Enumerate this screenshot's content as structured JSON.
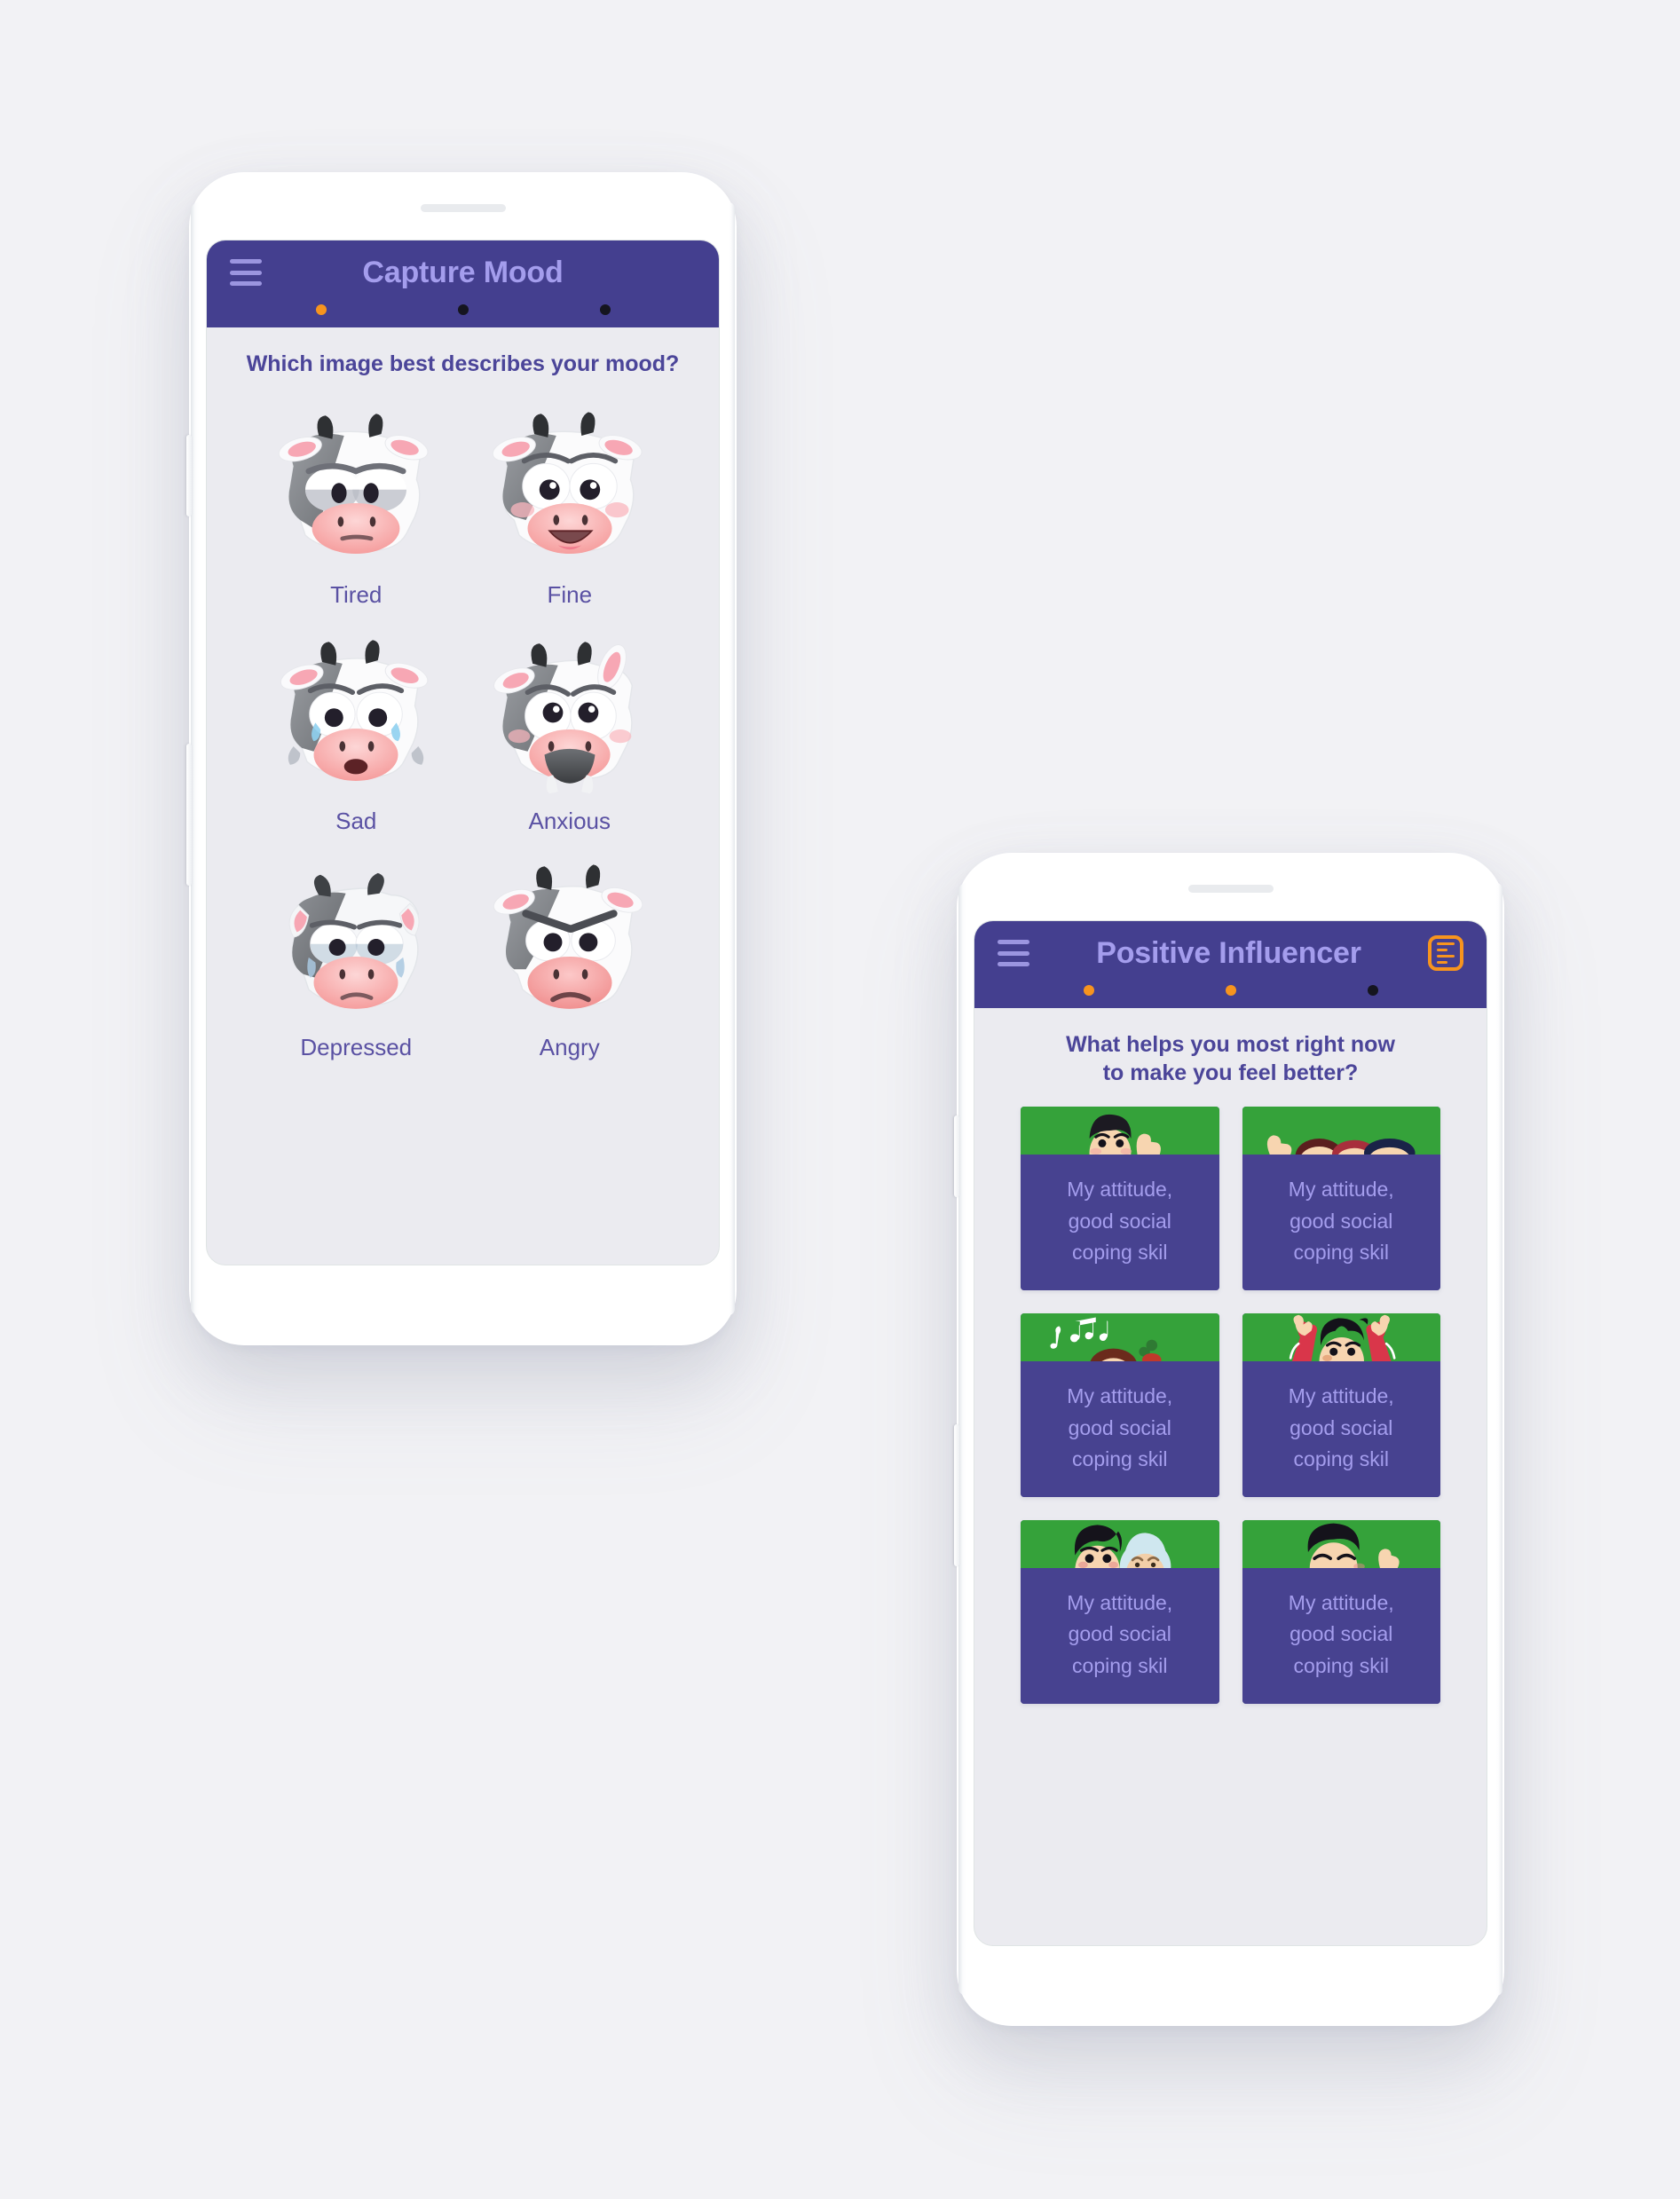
{
  "background_color": "#f2f2f5",
  "theme": {
    "purple": "#443f8f",
    "purple_light": "#a49ded",
    "orange": "#f7941e",
    "green": "#35a23a",
    "screen_bg": "#ebebf0",
    "text_purple": "#4b4599"
  },
  "phone_left": {
    "device_name": "smartphone-mockup-left",
    "appbar": {
      "menu_icon": "hamburger-menu-icon",
      "title": "Capture Mood",
      "dots": [
        {
          "state": "active",
          "color": "#f7941e"
        },
        {
          "state": "inactive",
          "color": "#15151f"
        },
        {
          "state": "inactive",
          "color": "#15151f"
        }
      ]
    },
    "question": "Which image best describes your mood?",
    "moods": [
      {
        "label": "Tired",
        "icon": "cow-face-tired-icon"
      },
      {
        "label": "Fine",
        "icon": "cow-face-fine-icon"
      },
      {
        "label": "Sad",
        "icon": "cow-face-sad-icon"
      },
      {
        "label": "Anxious",
        "icon": "cow-face-anxious-icon"
      },
      {
        "label": "Depressed",
        "icon": "cow-face-depressed-icon"
      },
      {
        "label": "Angry",
        "icon": "cow-face-angry-icon"
      }
    ]
  },
  "phone_right": {
    "device_name": "smartphone-mockup-right",
    "appbar": {
      "menu_icon": "hamburger-menu-icon",
      "title": "Positive Influencer",
      "action_icon": "list-form-icon",
      "dots": [
        {
          "state": "active",
          "color": "#f7941e"
        },
        {
          "state": "active",
          "color": "#f7941e"
        },
        {
          "state": "inactive",
          "color": "#15151f"
        }
      ]
    },
    "question_line1": "What helps you most right now",
    "question_line2": "to make you feel better?",
    "cards": [
      {
        "illustration": "person-thumbs-up-icon",
        "line1": "My attitude,",
        "line2": "good social",
        "line3": "coping skil"
      },
      {
        "illustration": "group-of-friends-icon",
        "line1": "My attitude,",
        "line2": "good social",
        "line3": "coping skil"
      },
      {
        "illustration": "music-and-nature-icon",
        "line1": "My attitude,",
        "line2": "good social",
        "line3": "coping skil"
      },
      {
        "illustration": "person-cheering-icon",
        "line1": "My attitude,",
        "line2": "good social",
        "line3": "coping skil"
      },
      {
        "illustration": "young-and-elder-icon",
        "line1": "My attitude,",
        "line2": "good social",
        "line3": "coping skil"
      },
      {
        "illustration": "happy-person-waving-icon",
        "line1": "My attitude,",
        "line2": "good social",
        "line3": "coping skil"
      }
    ]
  }
}
